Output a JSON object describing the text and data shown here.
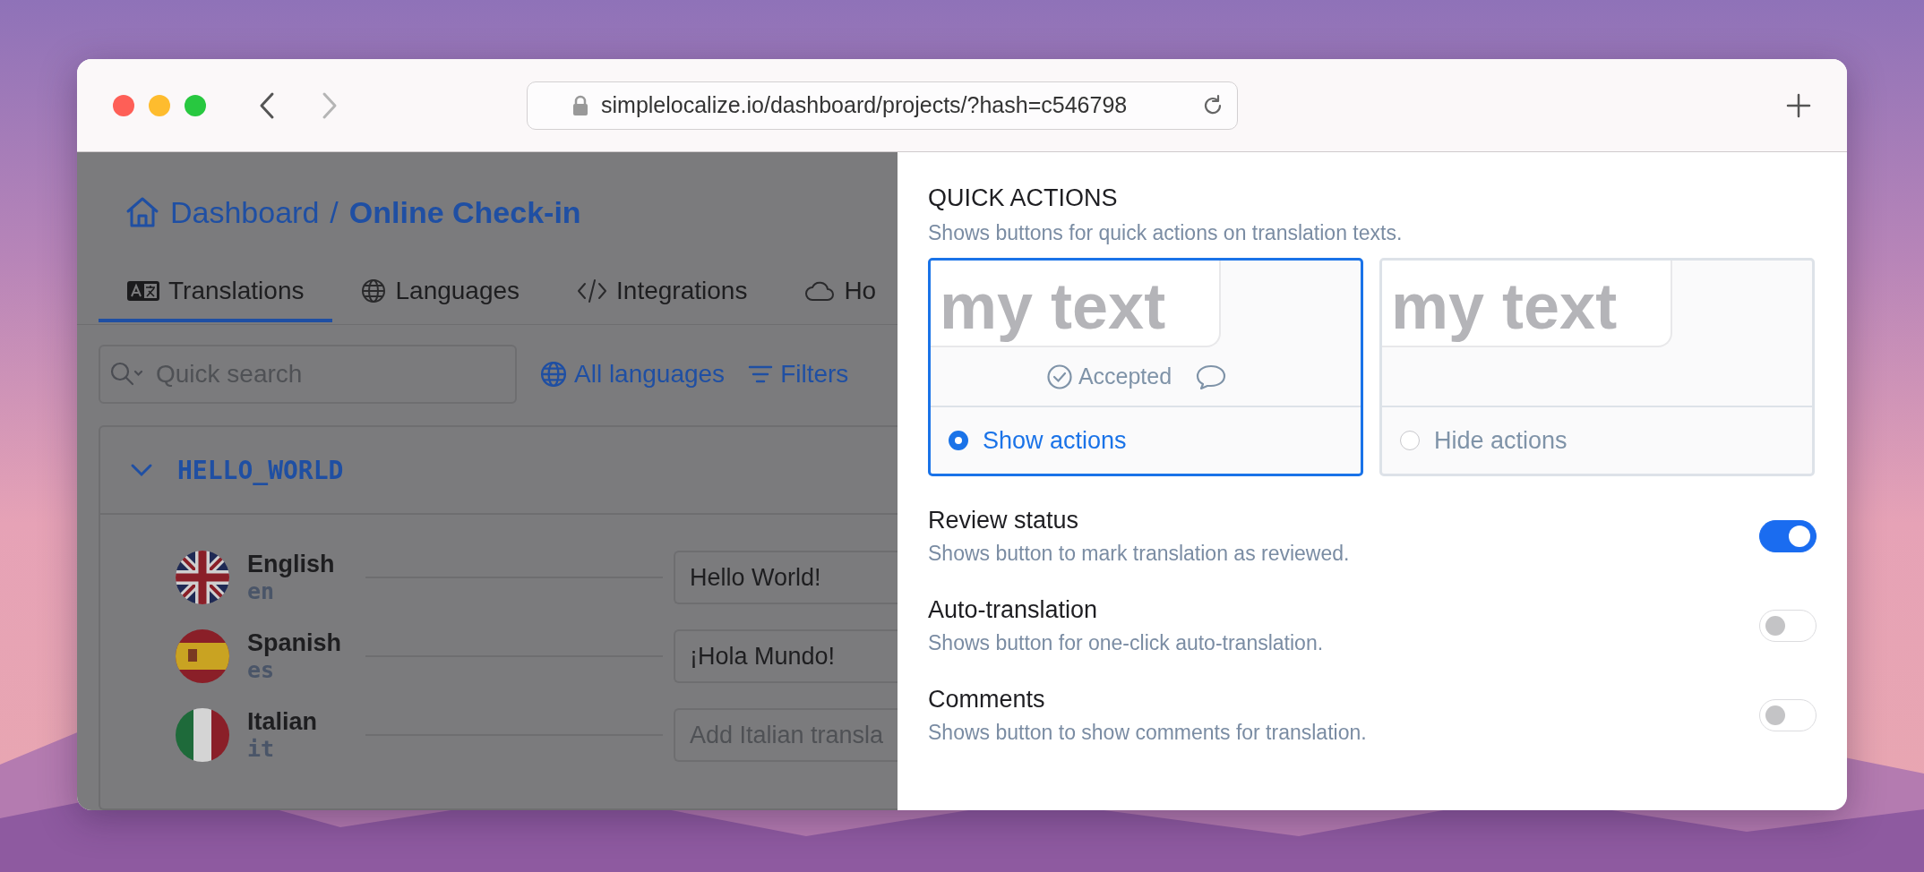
{
  "browser": {
    "url": "simplelocalize.io/dashboard/projects/?hash=c546798"
  },
  "breadcrumb": {
    "home": "Dashboard",
    "separator": "/",
    "current": "Online Check-in"
  },
  "tabs": [
    {
      "label": "Translations",
      "selected": true
    },
    {
      "label": "Languages",
      "selected": false
    },
    {
      "label": "Integrations",
      "selected": false
    },
    {
      "label": "Ho",
      "selected": false
    }
  ],
  "toolbar": {
    "search": {
      "placeholder": "Quick search"
    },
    "language_filter": "All languages",
    "filters": "Filters"
  },
  "translation_key": {
    "name": "HELLO_WORLD",
    "expanded": true,
    "languages": [
      {
        "name": "English",
        "code": "en",
        "value": "Hello World!"
      },
      {
        "name": "Spanish",
        "code": "es",
        "value": "¡Hola Mundo!"
      },
      {
        "name": "Italian",
        "code": "it",
        "placeholder": "Add Italian transla"
      }
    ]
  },
  "settings_panel": {
    "quick_actions": {
      "title": "QUICK ACTIONS",
      "description": "Shows buttons for quick actions on translation texts.",
      "options": [
        {
          "kind": "show",
          "preview_text": "my text",
          "status": "Accepted",
          "label": "Show actions",
          "selected": true
        },
        {
          "kind": "hide",
          "preview_text": "my text",
          "label": "Hide actions",
          "selected": false
        }
      ]
    },
    "toggles": [
      {
        "title": "Review status",
        "description": "Shows button to mark translation as reviewed.",
        "on": true
      },
      {
        "title": "Auto-translation",
        "description": "Shows button for one-click auto-translation.",
        "on": false
      },
      {
        "title": "Comments",
        "description": "Shows button to show comments for translation.",
        "on": false
      }
    ]
  }
}
